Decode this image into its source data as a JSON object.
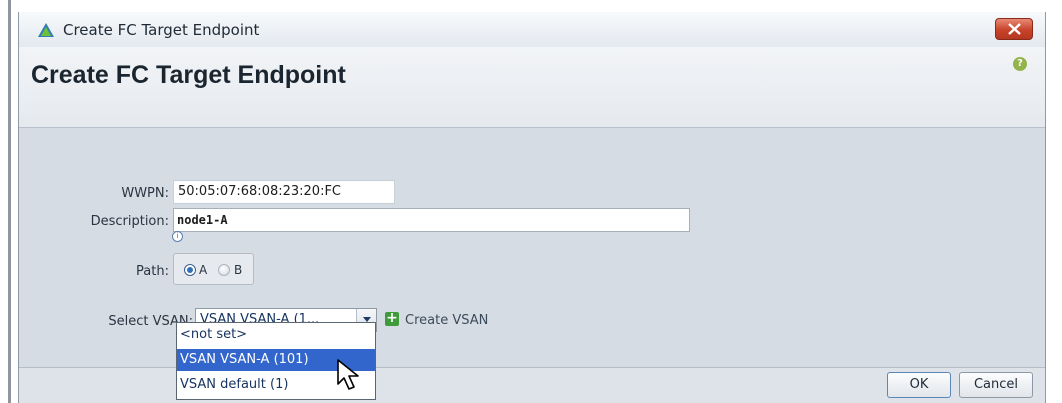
{
  "window": {
    "title": "Create FC Target Endpoint"
  },
  "header": {
    "title": "Create FC Target Endpoint",
    "help_icon": "help-icon"
  },
  "form": {
    "wwpn_label": "WWPN:",
    "wwpn_value": "50:05:07:68:08:23:20:FC",
    "description_label": "Description:",
    "description_value": "node1-A",
    "path_label": "Path:",
    "path_options": [
      {
        "label": "A",
        "selected": true
      },
      {
        "label": "B",
        "selected": false
      }
    ],
    "vsan_label": "Select VSAN:",
    "vsan_selected": "VSAN VSAN-A (1...",
    "create_vsan_label": "Create VSAN"
  },
  "dropdown": {
    "options": [
      "<not set>",
      "VSAN VSAN-A (101)",
      "VSAN default (1)"
    ],
    "highlighted_index": 1
  },
  "footer": {
    "ok_label": "OK",
    "cancel_label": "Cancel"
  },
  "colors": {
    "accent": "#3266cc",
    "close_button": "#c8432a",
    "create_icon": "#3f9b3a"
  }
}
